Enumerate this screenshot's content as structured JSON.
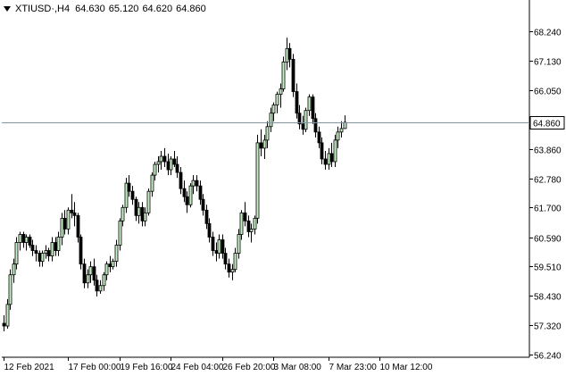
{
  "header": {
    "symbol": "XTIUSD·,H4",
    "open": "64.630",
    "high": "65.120",
    "low": "64.620",
    "close": "64.860"
  },
  "colors": {
    "background": "#ffffff",
    "axis": "#000000",
    "bull_fill": "#ffffff",
    "bear_fill": "#000000",
    "candle_outline": "#000000",
    "bull_alt_fill": "#c7f2c7",
    "price_line": "#7f97aa",
    "price_tag_bg": "#ffffff"
  },
  "chart_data": {
    "type": "candlestick",
    "y_ticks": [
      "68.240",
      "67.130",
      "66.050",
      "64.860",
      "63.860",
      "62.780",
      "61.700",
      "60.590",
      "59.510",
      "58.430",
      "57.320",
      "56.240"
    ],
    "y_tick_values": [
      68.24,
      67.13,
      66.05,
      64.86,
      63.86,
      62.78,
      61.7,
      60.59,
      59.51,
      58.43,
      57.32,
      56.24
    ],
    "ylim": [
      56.24,
      68.74
    ],
    "current_price_label": "64.860",
    "current_price": 64.86,
    "x_ticks": [
      "12 Feb 2021",
      "17 Feb 00:00",
      "19 Feb 16:00",
      "24 Feb 04:00",
      "26 Feb 20:00",
      "3 Mar 08:00",
      "7 Mar 23:00",
      "10 Mar 12:00"
    ],
    "x_tick_bar_index": [
      0,
      20,
      36,
      52,
      68,
      84,
      101,
      117
    ],
    "bar_count": 126,
    "candles": [
      [
        57.4,
        57.7,
        57.1,
        57.3
      ],
      [
        57.3,
        58.3,
        57.2,
        58.1
      ],
      [
        58.1,
        59.4,
        57.9,
        59.2
      ],
      [
        59.2,
        59.8,
        58.9,
        59.6
      ],
      [
        59.6,
        60.6,
        59.4,
        60.4
      ],
      [
        60.4,
        60.8,
        60.1,
        60.7
      ],
      [
        60.7,
        60.8,
        60.2,
        60.4
      ],
      [
        60.4,
        60.7,
        60.1,
        60.6
      ],
      [
        60.6,
        60.7,
        60.2,
        60.3
      ],
      [
        60.3,
        60.5,
        59.9,
        60.1
      ],
      [
        60.1,
        60.3,
        59.7,
        60.0
      ],
      [
        60.0,
        60.1,
        59.5,
        59.7
      ],
      [
        59.7,
        60.1,
        59.5,
        60.0
      ],
      [
        60.0,
        60.3,
        59.8,
        60.1
      ],
      [
        60.1,
        60.2,
        59.7,
        59.9
      ],
      [
        59.9,
        60.6,
        59.7,
        60.4
      ],
      [
        60.4,
        60.6,
        59.9,
        60.1
      ],
      [
        60.1,
        60.8,
        59.9,
        60.6
      ],
      [
        60.6,
        61.5,
        60.3,
        61.3
      ],
      [
        61.3,
        61.6,
        60.7,
        60.9
      ],
      [
        60.9,
        61.7,
        60.7,
        61.6
      ],
      [
        61.6,
        62.2,
        61.3,
        61.5
      ],
      [
        61.5,
        61.9,
        61.0,
        61.4
      ],
      [
        61.4,
        61.5,
        60.4,
        60.6
      ],
      [
        60.6,
        60.7,
        59.4,
        59.6
      ],
      [
        59.6,
        59.8,
        58.7,
        58.9
      ],
      [
        58.9,
        59.4,
        58.7,
        59.2
      ],
      [
        59.2,
        59.7,
        58.9,
        59.5
      ],
      [
        59.5,
        59.8,
        58.8,
        59.0
      ],
      [
        59.0,
        59.2,
        58.4,
        58.6
      ],
      [
        58.6,
        59.0,
        58.5,
        58.8
      ],
      [
        58.8,
        59.3,
        58.6,
        59.2
      ],
      [
        59.2,
        59.7,
        59.0,
        59.6
      ],
      [
        59.6,
        59.9,
        59.3,
        59.5
      ],
      [
        59.5,
        59.8,
        59.4,
        59.7
      ],
      [
        59.7,
        60.5,
        59.5,
        60.3
      ],
      [
        60.3,
        61.3,
        60.1,
        61.2
      ],
      [
        61.2,
        61.8,
        61.0,
        61.7
      ],
      [
        61.7,
        62.8,
        61.5,
        62.6
      ],
      [
        62.6,
        62.9,
        62.1,
        62.3
      ],
      [
        62.3,
        62.5,
        61.8,
        62.0
      ],
      [
        62.0,
        62.1,
        61.2,
        61.4
      ],
      [
        61.4,
        61.9,
        61.1,
        61.7
      ],
      [
        61.7,
        61.9,
        61.0,
        61.2
      ],
      [
        61.2,
        61.7,
        61.0,
        61.5
      ],
      [
        61.5,
        62.4,
        61.4,
        62.3
      ],
      [
        62.3,
        63.0,
        62.1,
        62.9
      ],
      [
        62.9,
        63.4,
        62.7,
        63.3
      ],
      [
        63.3,
        63.6,
        63.0,
        63.4
      ],
      [
        63.4,
        63.8,
        63.1,
        63.6
      ],
      [
        63.6,
        63.9,
        63.2,
        63.4
      ],
      [
        63.4,
        63.7,
        62.9,
        63.1
      ],
      [
        63.1,
        63.6,
        62.9,
        63.5
      ],
      [
        63.5,
        63.8,
        63.2,
        63.3
      ],
      [
        63.3,
        63.6,
        62.8,
        63.0
      ],
      [
        63.0,
        63.2,
        62.2,
        62.4
      ],
      [
        62.4,
        62.7,
        61.9,
        62.1
      ],
      [
        62.1,
        62.3,
        61.5,
        61.8
      ],
      [
        61.8,
        62.6,
        61.7,
        62.5
      ],
      [
        62.5,
        62.9,
        62.2,
        62.7
      ],
      [
        62.7,
        62.9,
        62.3,
        62.5
      ],
      [
        62.5,
        62.7,
        61.8,
        62.0
      ],
      [
        62.0,
        62.2,
        61.4,
        61.6
      ],
      [
        61.6,
        61.8,
        60.9,
        61.1
      ],
      [
        61.1,
        61.3,
        60.4,
        60.6
      ],
      [
        60.6,
        60.8,
        59.9,
        60.1
      ],
      [
        60.1,
        60.4,
        59.7,
        60.0
      ],
      [
        60.0,
        60.7,
        59.8,
        60.5
      ],
      [
        60.5,
        60.7,
        59.8,
        60.0
      ],
      [
        60.0,
        60.2,
        59.4,
        59.6
      ],
      [
        59.6,
        59.8,
        59.1,
        59.3
      ],
      [
        59.3,
        59.6,
        59.0,
        59.4
      ],
      [
        59.4,
        60.2,
        59.3,
        60.0
      ],
      [
        60.0,
        60.9,
        59.8,
        60.7
      ],
      [
        60.7,
        61.6,
        60.5,
        61.5
      ],
      [
        61.5,
        61.9,
        61.0,
        61.2
      ],
      [
        61.2,
        61.4,
        60.6,
        60.8
      ],
      [
        60.8,
        61.1,
        60.4,
        60.9
      ],
      [
        60.9,
        61.4,
        60.7,
        61.3
      ],
      [
        61.3,
        64.4,
        61.1,
        64.1
      ],
      [
        64.1,
        64.6,
        63.6,
        63.9
      ],
      [
        63.9,
        64.4,
        63.5,
        64.2
      ],
      [
        64.2,
        64.9,
        63.9,
        64.7
      ],
      [
        64.7,
        65.4,
        64.5,
        65.2
      ],
      [
        65.2,
        65.6,
        64.9,
        65.5
      ],
      [
        65.5,
        66.0,
        65.2,
        65.9
      ],
      [
        65.9,
        66.3,
        65.4,
        66.1
      ],
      [
        66.1,
        67.3,
        66.0,
        67.1
      ],
      [
        67.1,
        68.0,
        66.8,
        67.6
      ],
      [
        67.6,
        67.8,
        66.9,
        67.2
      ],
      [
        67.2,
        67.4,
        65.8,
        66.0
      ],
      [
        66.0,
        66.3,
        65.0,
        65.2
      ],
      [
        65.2,
        65.5,
        64.6,
        64.8
      ],
      [
        64.8,
        65.1,
        64.4,
        64.6
      ],
      [
        64.6,
        65.4,
        64.5,
        65.3
      ],
      [
        65.3,
        65.9,
        65.1,
        65.8
      ],
      [
        65.8,
        65.9,
        64.8,
        65.0
      ],
      [
        65.0,
        65.2,
        64.3,
        64.5
      ],
      [
        64.5,
        64.7,
        63.9,
        64.1
      ],
      [
        64.1,
        64.3,
        63.3,
        63.5
      ],
      [
        63.5,
        63.8,
        63.1,
        63.3
      ],
      [
        63.3,
        63.9,
        63.1,
        63.7
      ],
      [
        63.7,
        64.1,
        63.2,
        63.4
      ],
      [
        63.4,
        64.4,
        63.2,
        64.2
      ],
      [
        64.2,
        64.7,
        63.9,
        64.5
      ],
      [
        64.5,
        64.9,
        64.3,
        64.63
      ],
      [
        64.63,
        65.12,
        64.62,
        64.86
      ]
    ]
  }
}
